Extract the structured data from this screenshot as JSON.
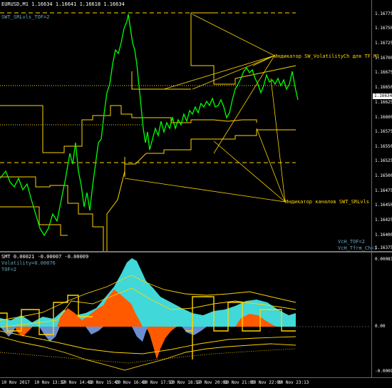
{
  "main_chart": {
    "header": "EURUSD,M1  1.16634 1.16641 1.16618 1.16634",
    "indicator_name": "SWT_SRLvls_TOF=2",
    "corner_label_1": "VcH_TOF=2",
    "corner_label_2": "VcH_Tfrm_Ch=1",
    "current_price": "1.16634",
    "price_axis": [
      "1.16775",
      "1.16750",
      "1.16725",
      "1.16700",
      "1.16675",
      "1.16650",
      "1.16625",
      "1.16600",
      "1.16575",
      "1.16550",
      "1.16525",
      "1.16500",
      "1.16475",
      "1.16450",
      "1.16425",
      "1.16400",
      "1.16375"
    ],
    "annotation_1": "Индикатор SW_VolatilityCh для TF M1",
    "annotation_2": "Индикатор каналов SWT_SRLvls",
    "colors": {
      "candles": "#00ff00",
      "levels": "#ffd400",
      "annotation": "#ffd400",
      "label_blue": "#6aa6b8"
    }
  },
  "sub_chart": {
    "header": "SMT  0.00021 -0.00007 -0.00009",
    "volatility_label": "Volatility=0.00076",
    "tof_label": "TOF=2",
    "axis_top": "0.00083",
    "axis_zero": "0.00",
    "axis_bottom": "-0.00097",
    "colors": {
      "cyan_fill": "#40d8d8",
      "orange_fill": "#ff5a00",
      "blue_fill": "#6b8fd0",
      "lines": "#ffd400"
    }
  },
  "time_axis": [
    "10 Nov 2017",
    "10 Nov 13:37",
    "10 Nov 14:41",
    "10 Nov 15:45",
    "10 Nov 16:49",
    "10 Nov 17:53",
    "10 Nov 18:57",
    "10 Nov 20:01",
    "10 Nov 21:05",
    "10 Nov 22:09",
    "10 Nov 23:13"
  ]
}
